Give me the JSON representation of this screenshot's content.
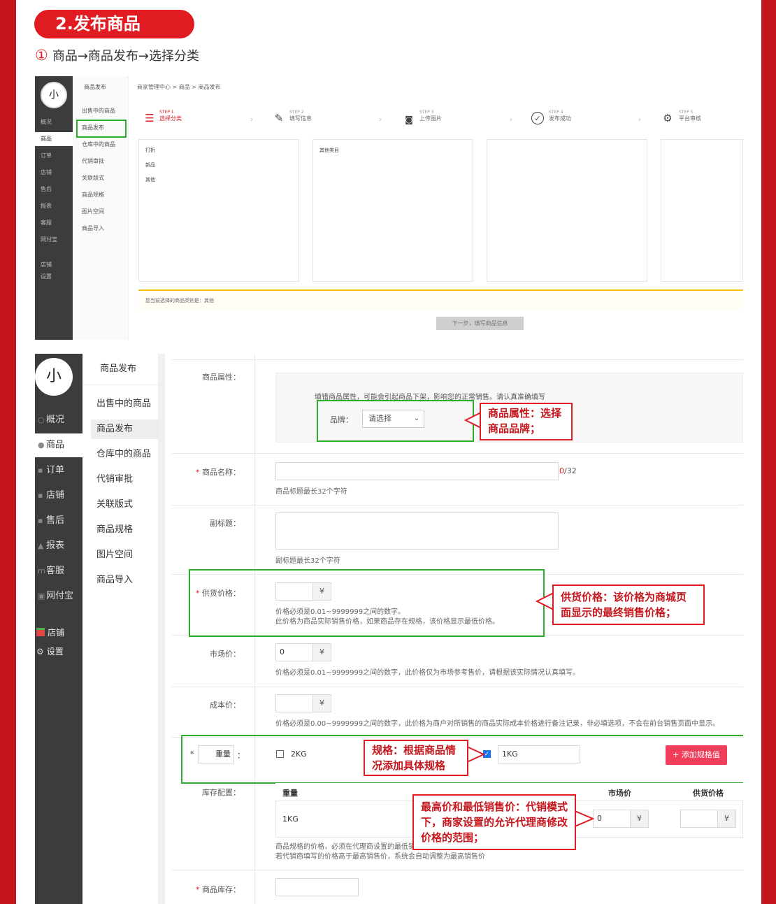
{
  "header": {
    "section_title": "2.发布商品",
    "step_number": "①",
    "step_path": "商品→商品发布→选择分类"
  },
  "colors": {
    "accent_red": "#e01b22",
    "frame_red": "#c4161c",
    "highlight_green": "#2cae2c",
    "sidebar": "#3c3c3c"
  },
  "shot1": {
    "logo_text": "小",
    "nav": [
      "概况",
      "商品",
      "订单",
      "店铺",
      "售后",
      "报表",
      "客服",
      "网付宝",
      "店铺",
      "设置"
    ],
    "sub_title": "商品发布",
    "sub_items": [
      "出售中的商品",
      "商品发布",
      "仓库中的商品",
      "代销审批",
      "关联版式",
      "商品规格",
      "图片空间",
      "商品导入"
    ],
    "breadcrumb": "商家管理中心 > 商品 > 商品发布",
    "steps": [
      {
        "step": "STEP 1",
        "label": "选择分类",
        "icon": "clipboard-icon"
      },
      {
        "step": "STEP 2",
        "label": "填写信息",
        "icon": "edit-icon"
      },
      {
        "step": "STEP 3",
        "label": "上传图片",
        "icon": "camera-icon"
      },
      {
        "step": "STEP 4",
        "label": "发布成功",
        "icon": "check-circle-icon"
      },
      {
        "step": "STEP 5",
        "label": "平台审核",
        "icon": "audit-icon"
      }
    ],
    "step_arrow": "›",
    "category_col1": [
      "打折",
      "新品",
      "其他"
    ],
    "category_col2": [
      "其他类目"
    ],
    "notice": "您当前选择的商品类别是：其他",
    "next_button": "下一步，填写商品信息"
  },
  "shot2": {
    "logo_text": "小",
    "nav": [
      {
        "icon": "search-icon",
        "label": "概况"
      },
      {
        "icon": "goods-icon",
        "label": "商品"
      },
      {
        "icon": "order-icon",
        "label": "订单"
      },
      {
        "icon": "shop-icon",
        "label": "店铺"
      },
      {
        "icon": "after-sale-icon",
        "label": "售后"
      },
      {
        "icon": "report-icon",
        "label": "报表"
      },
      {
        "icon": "service-icon",
        "label": "客服"
      },
      {
        "icon": "wallet-icon",
        "label": "网付宝"
      }
    ],
    "bottom_nav": [
      {
        "icon": "store-icon",
        "label": "店铺"
      },
      {
        "icon": "gear-icon",
        "label": "设置"
      }
    ],
    "sub_title": "商品发布",
    "sub_items": [
      "出售中的商品",
      "商品发布",
      "仓库中的商品",
      "代销审批",
      "关联版式",
      "商品规格",
      "图片空间",
      "商品导入"
    ],
    "form": {
      "attr_label": "商品属性：",
      "attr_tip": "填错商品属性，可能会引起商品下架，影响您的正常销售。请认真准确填写",
      "brand_label": "品牌：",
      "brand_select": "请选择",
      "name_label": "商品名称：",
      "name_counter_used": "0",
      "name_counter_max": "/32",
      "name_hint": "商品标题最长32个字符",
      "subtitle_label": "副标题：",
      "subtitle_hint": "副标题最长32个字符",
      "supply_label": "供货价格：",
      "supply_hint1": "价格必须是0.01~9999999之间的数字。",
      "supply_hint2": "此价格为商品实际销售价格，如果商品存在规格，该价格显示最低价格。",
      "market_label": "市场价：",
      "market_value": "0",
      "market_hint": "价格必须是0.01~9999999之间的数字，此价格仅为市场参考售价，请根据该实际情况认真填写。",
      "cost_label": "成本价：",
      "cost_hint": "价格必须是0.00~9999999之间的数字，此价格为商户对所销售的商品实际成本价格进行备注记录，非必填选项，不会在前台销售页面中显示。",
      "yen": "¥",
      "weight_label": "重量",
      "weight_colon": "：",
      "spec_option1": "2KG",
      "spec_option2_value": "1KG",
      "add_spec_button": "+ 添加规格值",
      "stock_label": "库存配置：",
      "stock_headers": [
        "重量",
        "市场价",
        "供货价格"
      ],
      "stock_row_spec": "1KG",
      "stock_row_market": "0",
      "stock_hint1": "商品规格的价格，必须在代理商设置的最低销售价和最高销售价之间",
      "stock_hint2": "若代销商填写的价格高于最高销售价，系统会自动调整为最高销售价",
      "inventory_label": "商品库存：",
      "required_mark": "*"
    },
    "callouts": {
      "brand": "商品属性：选择商品品牌；",
      "supply": "供货价格：该价格为商城页面显示的最终销售价格；",
      "spec": "规格：根据商品情况添加具体规格",
      "price_range": "最高价和最低销售价：代销模式下，商家设置的允许代理商修改价格的范围；"
    }
  }
}
